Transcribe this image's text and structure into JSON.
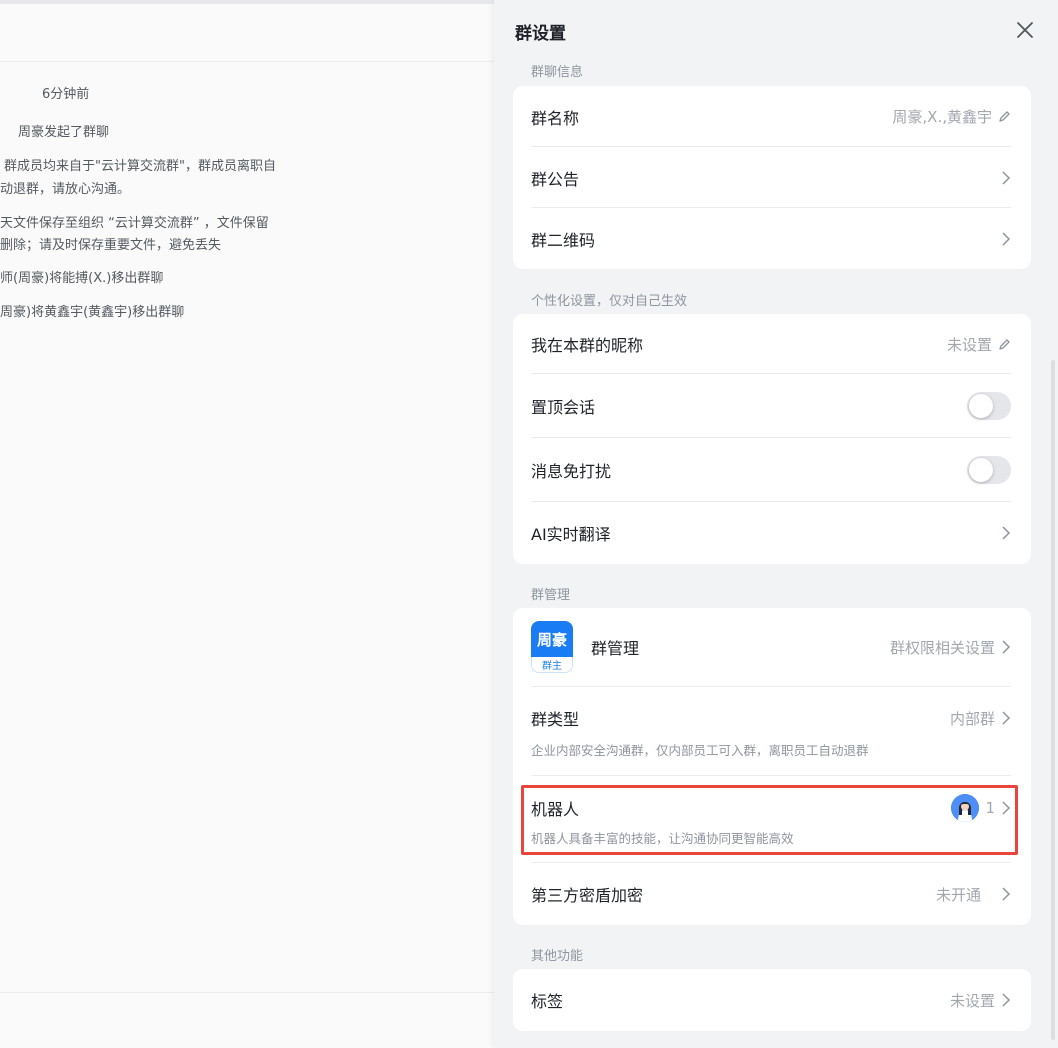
{
  "chat": {
    "messages": [
      {
        "text": "6分钟前"
      },
      {
        "text": "周豪发起了群聊"
      },
      {
        "text": "群成员均来自于\"云计算交流群\"，群成员离职自"
      },
      {
        "text": "动退群，请放心沟通。"
      },
      {
        "text": "天文件保存至组织 “云计算交流群” ，文件保留"
      },
      {
        "text": "删除；请及时保存重要文件，避免丢失"
      },
      {
        "text": "师(周豪)将能搏(X.)移出群聊"
      },
      {
        "text": "周豪)将黄鑫宇(黄鑫宇)移出群聊"
      }
    ]
  },
  "panel": {
    "title": "群设置",
    "sections": {
      "info": {
        "label": "群聊信息",
        "group_name_label": "群名称",
        "group_name_value": "周豪,X.,黄鑫宇",
        "announcement_label": "群公告",
        "qrcode_label": "群二维码"
      },
      "personal": {
        "label": "个性化设置，仅对自己生效",
        "nickname_label": "我在本群的昵称",
        "nickname_value": "未设置",
        "pin_label": "置顶会话",
        "pin_on": false,
        "mute_label": "消息免打扰",
        "mute_on": false,
        "translate_label": "AI实时翻译"
      },
      "manage": {
        "label": "群管理",
        "owner_name": "周豪",
        "owner_role": "群主",
        "manage_label": "群管理",
        "manage_value": "群权限相关设置",
        "type_label": "群类型",
        "type_value": "内部群",
        "type_desc": "企业内部安全沟通群，仅内部员工可入群，离职员工自动退群",
        "bot_label": "机器人",
        "bot_count": "1",
        "bot_desc": "机器人具备丰富的技能，让沟通协同更智能高效",
        "encrypt_label": "第三方密盾加密",
        "encrypt_value": "未开通"
      },
      "other": {
        "label": "其他功能",
        "tags_label": "标签",
        "tags_value": "未设置"
      }
    }
  },
  "colors": {
    "accent": "#1a7cf5",
    "highlight": "#e8453c",
    "panel_bg": "#f2f3f5"
  }
}
